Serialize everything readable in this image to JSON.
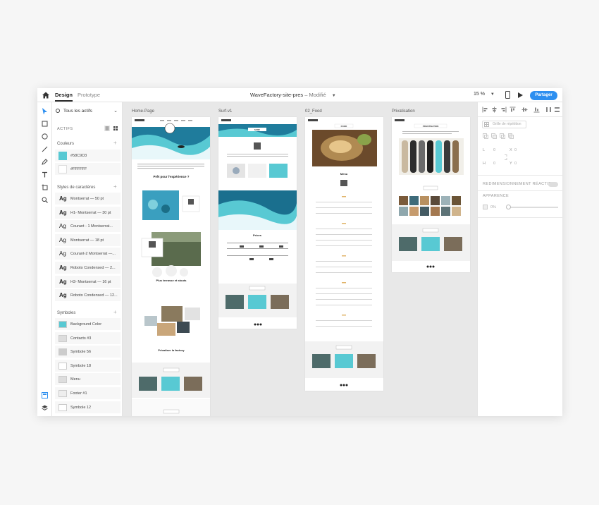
{
  "topbar": {
    "tab_design": "Design",
    "tab_prototype": "Prototype",
    "doc_name": "WaveFactory-site-pres",
    "doc_separator": "–",
    "doc_status": "Modifié",
    "zoom": "15 %",
    "share_label": "Partager",
    "accent": "#2d8ff0"
  },
  "assets": {
    "search_label": "Tous les actifs",
    "header": "ACTIFS",
    "colors_label": "Couleurs",
    "colors": [
      {
        "hex": "#58C9D3",
        "label": "#58C9D3"
      },
      {
        "hex": "#FFFFFF",
        "label": "#FFFFFF"
      }
    ],
    "char_styles_label": "Styles de caractères",
    "char_styles": [
      {
        "glyph": "Ag",
        "label": "Montserrat — 50 pt",
        "bold": true
      },
      {
        "glyph": "Ag",
        "label": "H1- Montserrat — 30 pt",
        "bold": true
      },
      {
        "glyph": "Ag",
        "label": "Courant - 1 Montserrat...",
        "bold": false
      },
      {
        "glyph": "Ag",
        "label": "Montserrat — 18 pt",
        "bold": false
      },
      {
        "glyph": "Ag",
        "label": "Courant-2 Montserrat —...",
        "bold": false
      },
      {
        "glyph": "Ag",
        "label": "Roboto Condensed — 2...",
        "bold": true
      },
      {
        "glyph": "Ag",
        "label": "H3- Montserrat — 16 pt",
        "bold": true
      },
      {
        "glyph": "Ag",
        "label": "Roboto Condensed — 12...",
        "bold": true
      }
    ],
    "symbols_label": "Symboles",
    "symbols": [
      {
        "label": "Background Color",
        "icon": "wave-thumbnail-icon"
      },
      {
        "label": "Contacts #3",
        "icon": "contacts-thumbnail-icon"
      },
      {
        "label": "Symbole 56",
        "icon": "surfboard-thumbnail-icon"
      },
      {
        "label": "Symbole 18",
        "icon": "triangle-thumbnail-icon"
      },
      {
        "label": "Menu",
        "icon": "menu-thumbnail-icon"
      },
      {
        "label": "Footer #1",
        "icon": "footer-thumbnail-icon"
      },
      {
        "label": "Symbole 12",
        "icon": "logo-thumbnail-icon"
      }
    ]
  },
  "canvas": {
    "artboards": [
      {
        "label": "Home-Page"
      },
      {
        "label": "Surf-v1"
      },
      {
        "label": "02_Food"
      },
      {
        "label": "Privatisation"
      }
    ],
    "home": {
      "heading1": "Prêt pour l'expérience ?",
      "heading2": "Plus terrasse et stouts",
      "heading3": "Privatiser la factory"
    },
    "surf": {
      "badge": "SURF",
      "prices": "Prices"
    },
    "food": {
      "badge": "FOOD",
      "menu": "Menu"
    },
    "priv": {
      "badge": "PRIVATISATION"
    }
  },
  "props": {
    "grid_label": "Grille de répétition",
    "l_label": "L",
    "l_value": "0",
    "x_label": "X",
    "x_value": "0",
    "h_label": "H",
    "h_value": "0",
    "y_label": "Y",
    "y_value": "0",
    "resize_label": "REDIMENSIONNEMENT RÉACTIF",
    "appearance_label": "APPARENCE",
    "opacity_value": "0%"
  }
}
